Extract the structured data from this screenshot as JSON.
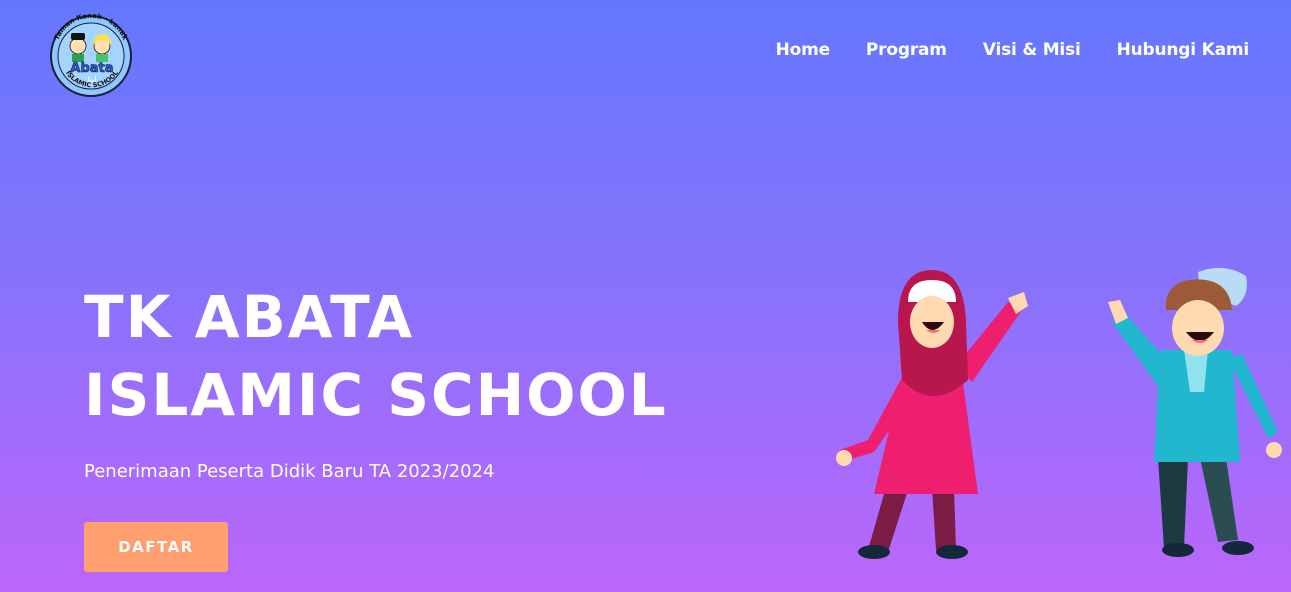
{
  "logo": {
    "top_text": "Taman Kanak - kanak",
    "brand": "Abata",
    "arabic": "ابتا",
    "bottom_text": "ISLAMIC SCHOOL"
  },
  "nav": {
    "items": [
      "Home",
      "Program",
      "Visi & Misi",
      "Hubungi Kami"
    ]
  },
  "hero": {
    "title_line1": "TK ABATA",
    "title_line2": "ISLAMIC SCHOOL",
    "subtitle": "Penerimaan Peserta Didik Baru TA 2023/2024",
    "cta_label": "DAFTAR"
  },
  "colors": {
    "gradient_top": "#6378fe",
    "gradient_bottom": "#bc66fb",
    "cta_bg": "#ff9f6d",
    "girl_dress": "#ef1f6f",
    "boy_shirt": "#21b7cf"
  }
}
